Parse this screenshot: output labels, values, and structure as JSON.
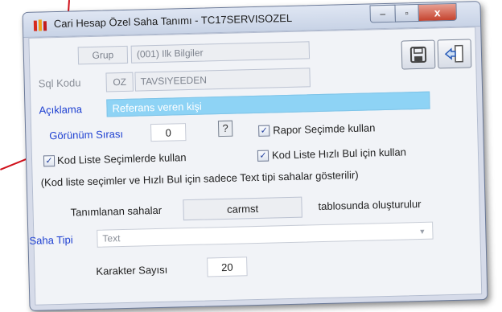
{
  "window": {
    "title": "Cari Hesap Özel Saha Tanımı - TC17SERVISOZEL",
    "minimize": "–",
    "maximize": "▫",
    "close": "x"
  },
  "grup": {
    "label": "Grup",
    "value": "(001) Ilk Bilgiler"
  },
  "sql_kodu": {
    "label": "Sql Kodu",
    "prefix": "OZ",
    "value": "TAVSIYEEDEN"
  },
  "aciklama": {
    "label": "Açıklama",
    "value": "Referans veren kişi"
  },
  "gorunum": {
    "label": "Görünüm Sırası",
    "value": "0",
    "help": "?"
  },
  "rapor_secimde": {
    "label": "Rapor Seçimde kullan",
    "checked": true,
    "mark": "✓"
  },
  "kod_liste_secim": {
    "label": "Kod Liste Seçimlerde kullan",
    "checked": true,
    "mark": "✓"
  },
  "kod_liste_hizli": {
    "label": "Kod Liste Hızlı Bul için kullan",
    "checked": true,
    "mark": "✓"
  },
  "note": "(Kod liste seçimler ve Hızlı Bul için sadece Text tipi sahalar gösterilir)",
  "tablo": {
    "prefix": "Tanımlanan sahalar",
    "value": "carmst",
    "suffix": "tablosunda oluşturulur"
  },
  "saha_tipi": {
    "label": "Saha Tipi",
    "value": "Text"
  },
  "karakter": {
    "label": "Karakter Sayısı",
    "value": "20"
  },
  "icons": {
    "save": "save-icon",
    "exit": "exit-door-icon",
    "app": "app-logo-icon"
  },
  "colors": {
    "accent_blue": "#1d3fd1",
    "field_highlight": "#8ed3f5",
    "pointer_red": "#d0101a"
  }
}
